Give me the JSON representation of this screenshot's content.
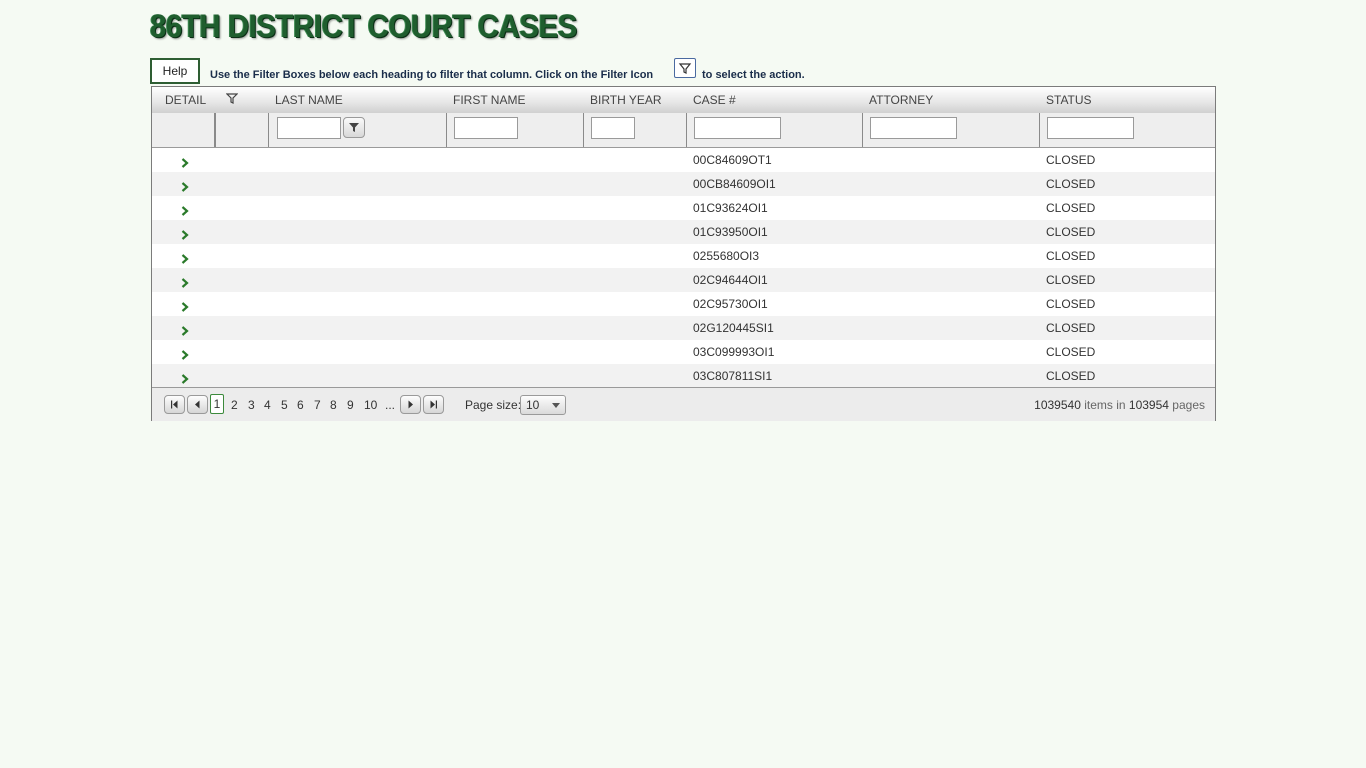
{
  "page_title": "86TH DISTRICT COURT CASES",
  "help": {
    "button_label": "Help",
    "instruction_part1": "Use the Filter Boxes below each heading to filter that column.  Click on the Filter Icon",
    "instruction_part2": "to select the action."
  },
  "grid": {
    "columns": [
      "DETAIL",
      "LAST NAME",
      "FIRST NAME",
      "BIRTH YEAR",
      "CASE #",
      "ATTORNEY",
      "STATUS"
    ],
    "rows": [
      {
        "case": "00C84609OT1",
        "status": "CLOSED"
      },
      {
        "case": "00CB84609OI1",
        "status": "CLOSED"
      },
      {
        "case": "01C93624OI1",
        "status": "CLOSED"
      },
      {
        "case": "01C93950OI1",
        "status": "CLOSED"
      },
      {
        "case": "0255680OI3",
        "status": "CLOSED"
      },
      {
        "case": "02C94644OI1",
        "status": "CLOSED"
      },
      {
        "case": "02C95730OI1",
        "status": "CLOSED"
      },
      {
        "case": "02G120445SI1",
        "status": "CLOSED"
      },
      {
        "case": "03C099993OI1",
        "status": "CLOSED"
      },
      {
        "case": "03C807811SI1",
        "status": "CLOSED"
      }
    ]
  },
  "pager": {
    "pages": [
      "1",
      "2",
      "3",
      "4",
      "5",
      "6",
      "7",
      "8",
      "9",
      "10"
    ],
    "ellipsis": "...",
    "current_page": "1",
    "page_size_label": "Page size:",
    "page_size_value": "10",
    "total_items": "1039540",
    "items_in_label": "items in",
    "total_pages": "103954",
    "pages_label": "pages"
  },
  "colors": {
    "background": "#f5faf3",
    "title_green": "#1f5e2e",
    "chevron_green": "#2a7a2a"
  },
  "icons": [
    "filter-icon",
    "chevron-right-icon",
    "first-page-icon",
    "prev-page-icon",
    "next-page-icon",
    "last-page-icon",
    "dropdown-arrow-icon"
  ]
}
